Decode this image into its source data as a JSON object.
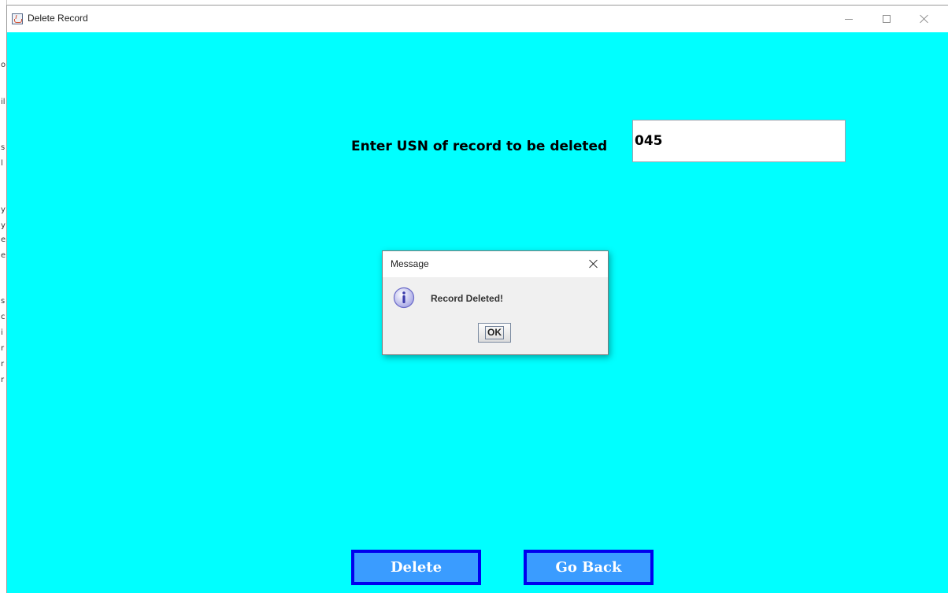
{
  "window": {
    "title": "Delete Record",
    "app_icon": "java-coffee-cup-icon",
    "controls": [
      "minimize-icon",
      "maximize-icon",
      "close-icon"
    ],
    "background_color": "#00ffff"
  },
  "form": {
    "usn_label": "Enter USN of record to be deleted",
    "usn_value": "045"
  },
  "buttons": {
    "delete_label": "Delete",
    "back_label": "Go Back",
    "fill_color": "#3a9cff",
    "border_color": "#0000ee"
  },
  "dialog": {
    "title": "Message",
    "icon": "info-icon",
    "message": "Record Deleted!",
    "ok_label": "OK"
  }
}
